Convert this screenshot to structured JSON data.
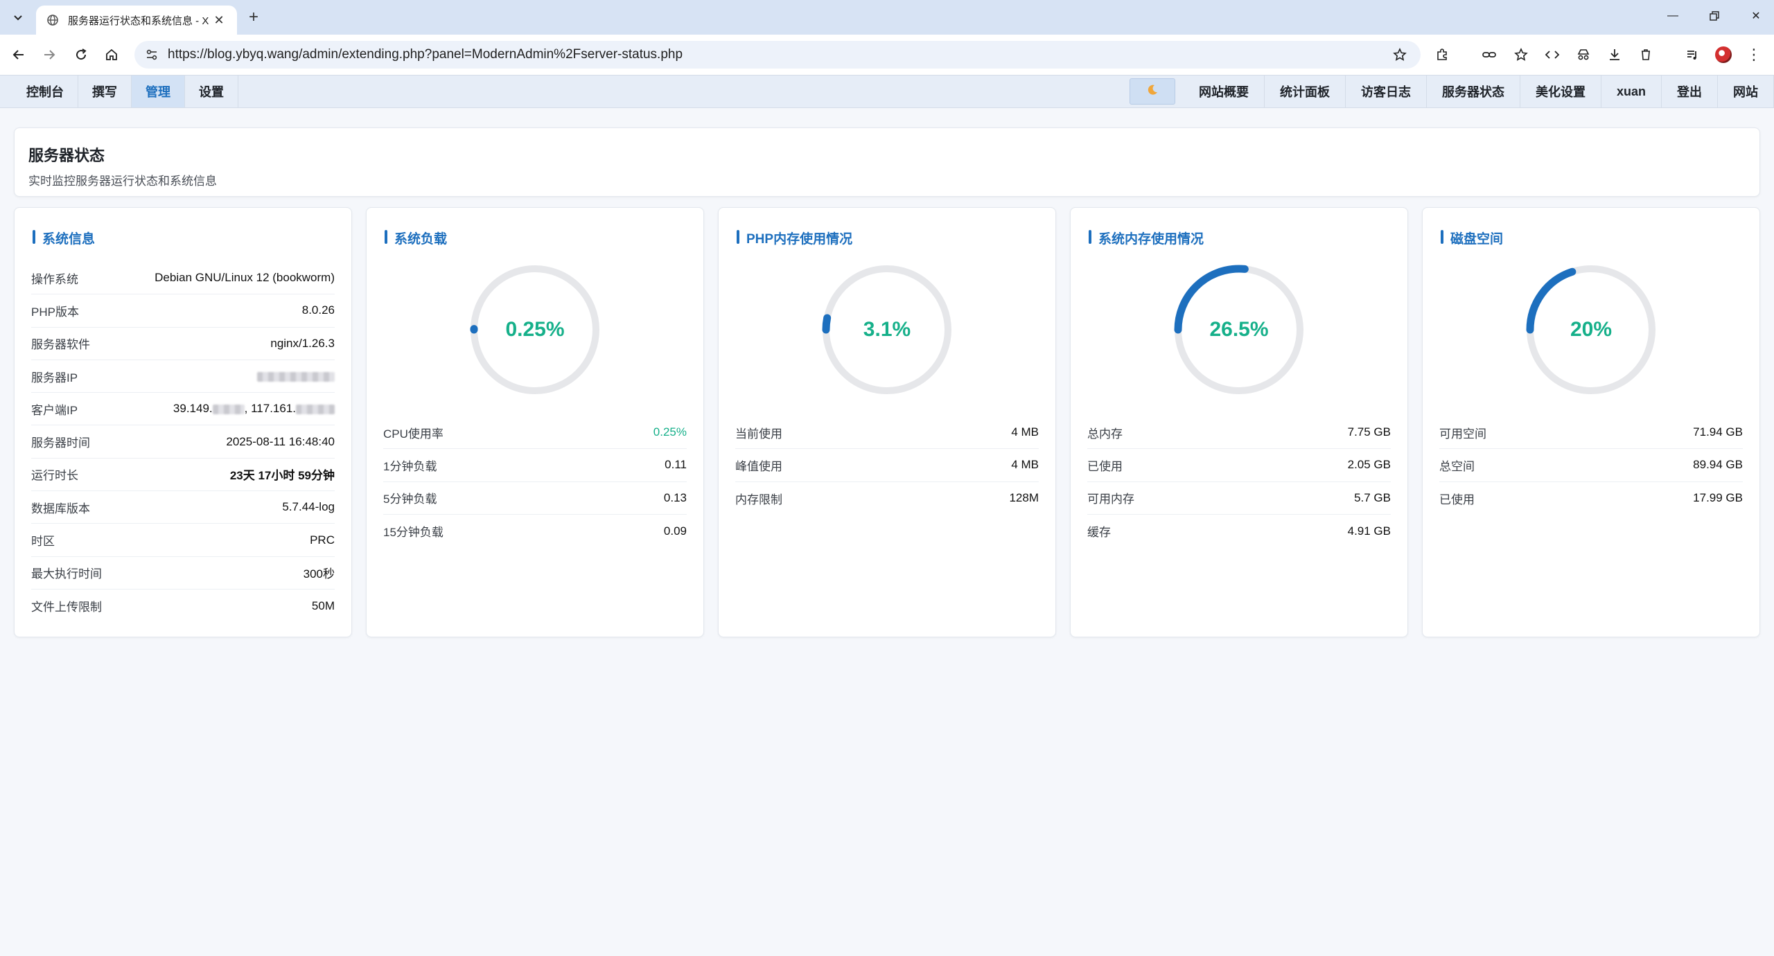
{
  "browser": {
    "tab_title": "服务器运行状态和系统信息 - X",
    "url": "https://blog.ybyq.wang/admin/extending.php?panel=ModernAdmin%2Fserver-status.php"
  },
  "nav": {
    "left": [
      "控制台",
      "撰写",
      "管理",
      "设置"
    ],
    "active": "管理",
    "right": [
      "网站概要",
      "统计面板",
      "访客日志",
      "服务器状态",
      "美化设置",
      "xuan",
      "登出",
      "网站"
    ]
  },
  "page": {
    "title": "服务器状态",
    "subtitle": "实时监控服务器运行状态和系统信息"
  },
  "system_info": {
    "title": "系统信息",
    "rows": [
      {
        "label": "操作系统",
        "value": "Debian GNU/Linux 12 (bookworm)"
      },
      {
        "label": "PHP版本",
        "value": "8.0.26"
      },
      {
        "label": "服务器软件",
        "value": "nginx/1.26.3"
      },
      {
        "label": "服务器IP",
        "value": ""
      },
      {
        "label": "客户端IP",
        "value_a": "39.149.",
        "value_b": ", 117.161."
      },
      {
        "label": "服务器时间",
        "value": "2025-08-11 16:48:40"
      },
      {
        "label": "运行时长",
        "value": "23天 17小时 59分钟"
      },
      {
        "label": "数据库版本",
        "value": "5.7.44-log"
      },
      {
        "label": "时区",
        "value": "PRC"
      },
      {
        "label": "最大执行时间",
        "value": "300秒"
      },
      {
        "label": "文件上传限制",
        "value": "50M"
      }
    ]
  },
  "load": {
    "title": "系统负载",
    "percent": 0.25,
    "display": "0.25%",
    "rows": [
      {
        "label": "CPU使用率",
        "value": "0.25%"
      },
      {
        "label": "1分钟负载",
        "value": "0.11"
      },
      {
        "label": "5分钟负载",
        "value": "0.13"
      },
      {
        "label": "15分钟负载",
        "value": "0.09"
      }
    ]
  },
  "php_mem": {
    "title": "PHP内存使用情况",
    "percent": 3.1,
    "display": "3.1%",
    "rows": [
      {
        "label": "当前使用",
        "value": "4 MB"
      },
      {
        "label": "峰值使用",
        "value": "4 MB"
      },
      {
        "label": "内存限制",
        "value": "128M"
      }
    ]
  },
  "sys_mem": {
    "title": "系统内存使用情况",
    "percent": 26.5,
    "display": "26.5%",
    "rows": [
      {
        "label": "总内存",
        "value": "7.75 GB"
      },
      {
        "label": "已使用",
        "value": "2.05 GB"
      },
      {
        "label": "可用内存",
        "value": "5.7 GB"
      },
      {
        "label": "缓存",
        "value": "4.91 GB"
      }
    ]
  },
  "disk": {
    "title": "磁盘空间",
    "percent": 20,
    "display": "20%",
    "rows": [
      {
        "label": "可用空间",
        "value": "71.94 GB"
      },
      {
        "label": "总空间",
        "value": "89.94 GB"
      },
      {
        "label": "已使用",
        "value": "17.99 GB"
      }
    ]
  },
  "colors": {
    "accent": "#1d6fbe",
    "gauge_track": "#e6e7ea",
    "value_green": "#16b08a"
  }
}
